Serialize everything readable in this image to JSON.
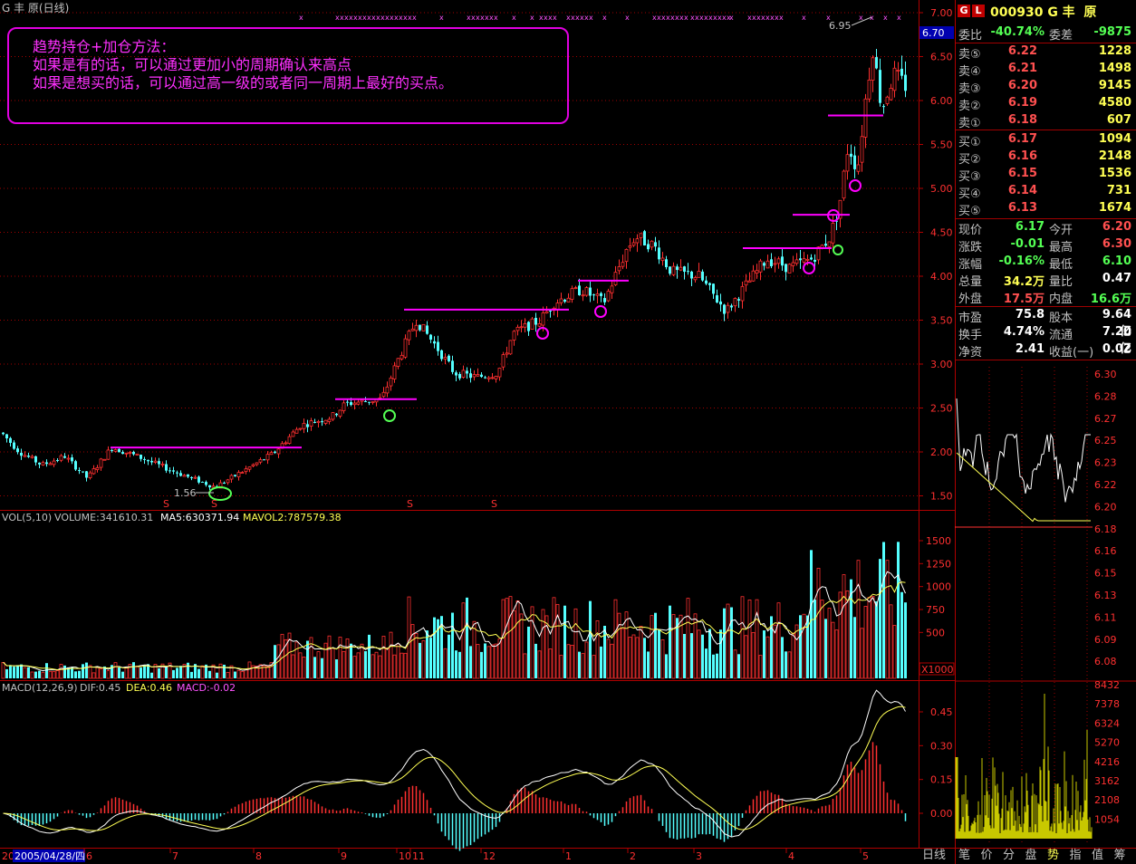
{
  "window": {
    "title": "G 丰  原(日线)"
  },
  "note": {
    "line1": "趋势持仓+加仓方法：",
    "line2": "如果是有的话，可以通过更加小的周期确认来高点",
    "line3": "如果是想买的话，可以通过高一级的或者同一周期上最好的买点。"
  },
  "price_axis": {
    "labels": [
      "7.00",
      "6.50",
      "6.00",
      "5.50",
      "5.00",
      "4.50",
      "4.00",
      "3.50",
      "3.00",
      "2.50",
      "2.00",
      "1.50"
    ],
    "current_tag": "6.70"
  },
  "annotations": {
    "high": "6.95",
    "low": "1.56",
    "markers": [
      "S",
      "S",
      "S",
      "S"
    ]
  },
  "volume_panel": {
    "header_vol": "VOL(5,10)",
    "header_volume": "VOLUME:341610.31",
    "header_ma5": "MA5:630371.94",
    "header_mavol2": "MAVOL2:787579.38",
    "axis": [
      "1500",
      "1250",
      "1000",
      "750",
      "500"
    ],
    "unit": "X1000"
  },
  "macd_panel": {
    "header_name": "MACD(12,26,9)",
    "header_dif": "DIF:0.45",
    "header_dea": "DEA:0.46",
    "header_macd": "MACD:-0.02",
    "axis": [
      "0.45",
      "0.30",
      "0.15",
      "0.00"
    ]
  },
  "date_axis": {
    "cursor_date": "2005/04/28/四",
    "months": [
      "6",
      "7",
      "8",
      "9",
      "10",
      "11",
      "12",
      "1",
      "2",
      "3",
      "4",
      "5"
    ],
    "left_stub": "20"
  },
  "quote": {
    "logo_g": "G",
    "logo_l": "L",
    "code_name": "000930 G 丰  原",
    "weibi_label": "委比",
    "weibi": "-40.74%",
    "weicha_label": "委差",
    "weicha": "-9875",
    "sells": [
      {
        "label": "卖⑤",
        "price": "6.22",
        "vol": "1228"
      },
      {
        "label": "卖④",
        "price": "6.21",
        "vol": "1498"
      },
      {
        "label": "卖③",
        "price": "6.20",
        "vol": "9145"
      },
      {
        "label": "卖②",
        "price": "6.19",
        "vol": "4580"
      },
      {
        "label": "卖①",
        "price": "6.18",
        "vol": "607"
      }
    ],
    "buys": [
      {
        "label": "买①",
        "price": "6.17",
        "vol": "1094"
      },
      {
        "label": "买②",
        "price": "6.16",
        "vol": "2148"
      },
      {
        "label": "买③",
        "price": "6.15",
        "vol": "1536"
      },
      {
        "label": "买④",
        "price": "6.14",
        "vol": "731"
      },
      {
        "label": "买⑤",
        "price": "6.13",
        "vol": "1674"
      }
    ],
    "stats": [
      {
        "l1": "现价",
        "v1": "6.17",
        "c1": "green",
        "l2": "今开",
        "v2": "6.20",
        "c2": "red"
      },
      {
        "l1": "涨跌",
        "v1": "-0.01",
        "c1": "green",
        "l2": "最高",
        "v2": "6.30",
        "c2": "red"
      },
      {
        "l1": "涨幅",
        "v1": "-0.16%",
        "c1": "green",
        "l2": "最低",
        "v2": "6.10",
        "c2": "green"
      },
      {
        "l1": "总量",
        "v1": "34.2万",
        "c1": "yellow",
        "l2": "量比",
        "v2": "0.47",
        "c2": "white"
      },
      {
        "l1": "外盘",
        "v1": "17.5万",
        "c1": "red",
        "l2": "内盘",
        "v2": "16.6万",
        "c2": "green"
      }
    ],
    "stats2": [
      {
        "l1": "市盈",
        "v1": "75.8",
        "l2": "股本",
        "v2": "9.64亿"
      },
      {
        "l1": "换手",
        "v1": "4.74%",
        "l2": "流通",
        "v2": "7.20亿"
      },
      {
        "l1": "净资",
        "v1": "2.41",
        "l2": "收益(一)",
        "v2": "0.02"
      }
    ]
  },
  "intraday": {
    "price_axis": [
      "6.30",
      "6.28",
      "6.27",
      "6.25",
      "6.23",
      "6.22",
      "6.20",
      "6.18",
      "6.16",
      "6.15",
      "6.13",
      "6.11",
      "6.09",
      "6.08"
    ],
    "vol_axis": [
      "8432",
      "7378",
      "6324",
      "5270",
      "4216",
      "3162",
      "2108",
      "1054"
    ]
  },
  "tabs": {
    "period": "日线",
    "items": [
      "笔",
      "价",
      "分",
      "盘",
      "势",
      "指",
      "值",
      "筹"
    ],
    "active": "势"
  }
}
